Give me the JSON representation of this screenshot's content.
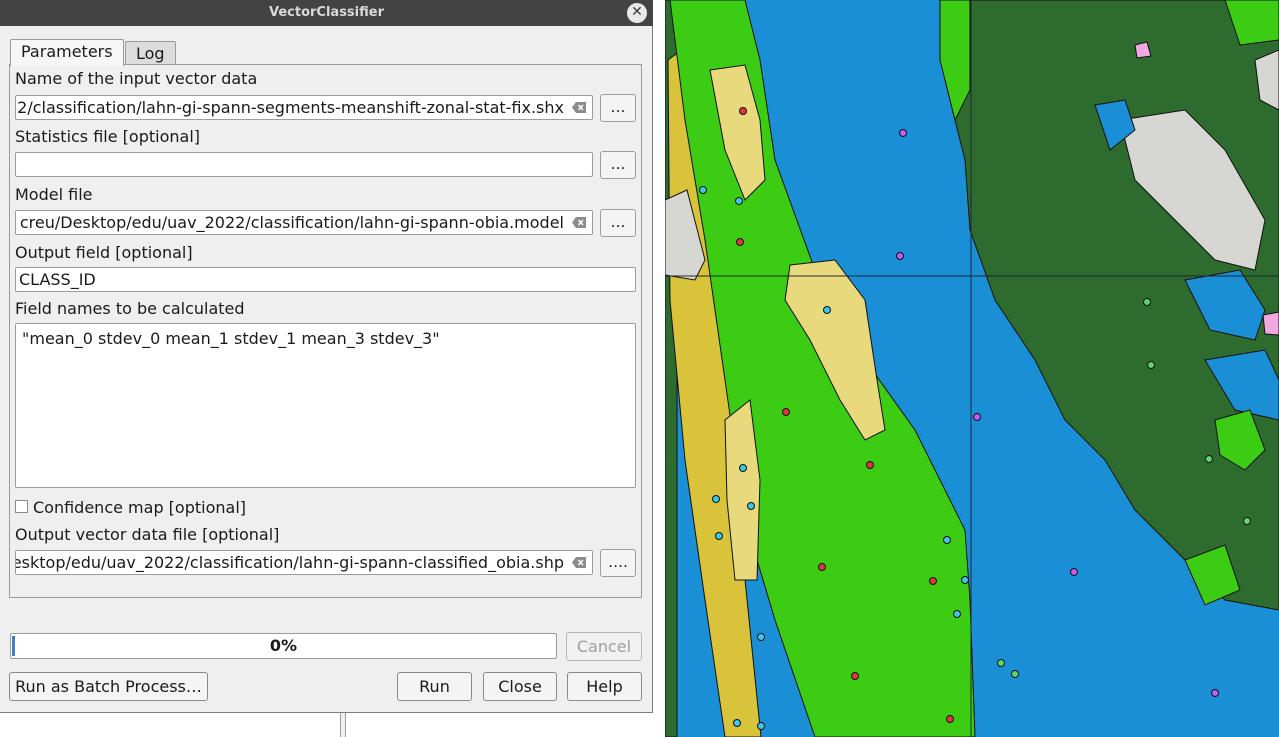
{
  "window": {
    "title": "VectorClassifier",
    "close_glyph": "✕"
  },
  "tabs": [
    {
      "label": "Parameters",
      "active": true
    },
    {
      "label": "Log",
      "active": false
    }
  ],
  "params": {
    "input_vector": {
      "label": "Name of the input vector data",
      "value": "2/classification/lahn-gi-spann-segments-meanshift-zonal-stat-fix.shx"
    },
    "stats_file": {
      "label": "Statistics file [optional]",
      "value": ""
    },
    "model_file": {
      "label": "Model file",
      "value": "creu/Desktop/edu/uav_2022/classification/lahn-gi-spann-obia.model"
    },
    "output_field": {
      "label": "Output field [optional]",
      "value": "CLASS_ID"
    },
    "field_names": {
      "label": "Field names to be calculated",
      "value": "\"mean_0 stdev_0 mean_1 stdev_1 mean_3 stdev_3\""
    },
    "confidence_map": {
      "label": "Confidence map [optional]",
      "checked": false
    },
    "output_vector": {
      "label": "Output vector data file [optional]",
      "value": "esktop/edu/uav_2022/classification/lahn-gi-spann-classified_obia.shp"
    },
    "browse_label": "…",
    "browse_label_menu": "…."
  },
  "progress": {
    "text": "0%",
    "value": 0
  },
  "buttons": {
    "cancel": "Cancel",
    "batch": "Run as Batch Process…",
    "run": "Run",
    "close": "Close",
    "help": "Help"
  },
  "colors": {
    "titlebar": "#434343",
    "water": "#1a8fd6",
    "forest": "#2e6b2f",
    "grass": "#3ccc14",
    "sand": "#e8d97c",
    "yellow": "#d8c33a",
    "grey": "#d6d6d2",
    "pink": "#f0a8e0"
  }
}
